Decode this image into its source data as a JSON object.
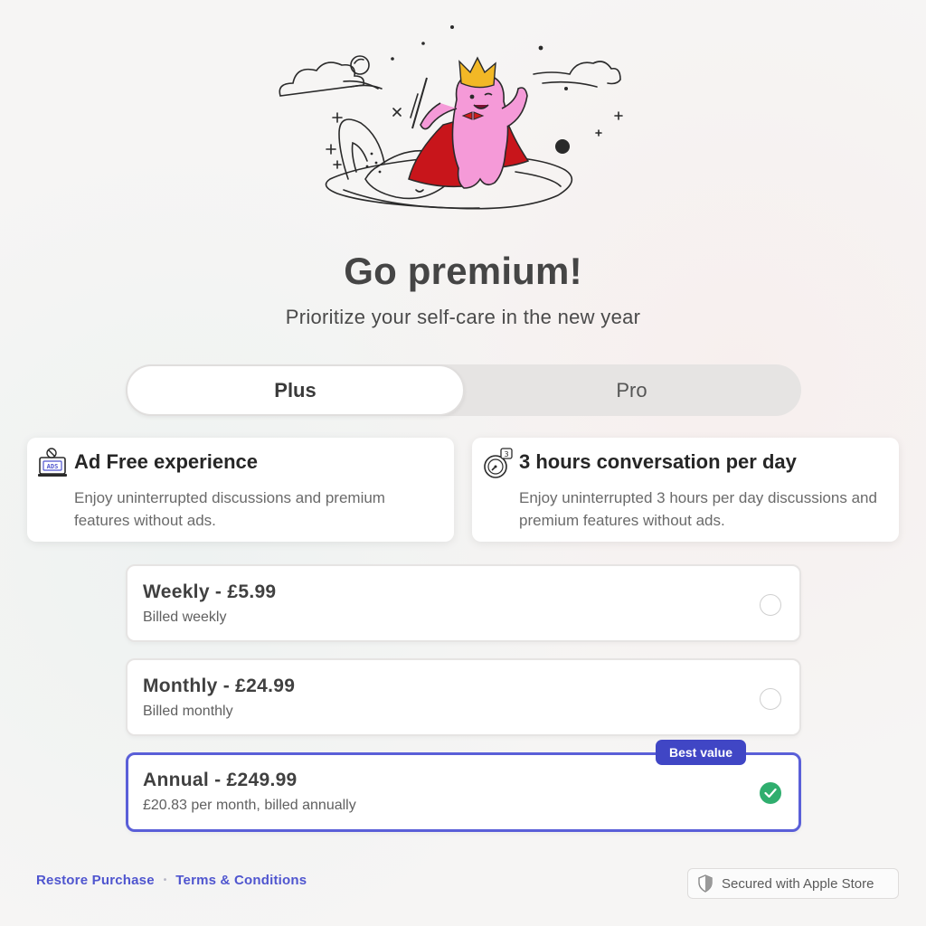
{
  "header": {
    "title": "Go premium!",
    "subtitle": "Prioritize your self-care in the new year"
  },
  "tabs": [
    {
      "label": "Plus",
      "selected": true
    },
    {
      "label": "Pro",
      "selected": false
    }
  ],
  "features": [
    {
      "icon": "no-ads-icon",
      "title": "Ad Free experience",
      "description": "Enjoy uninterrupted discussions and premium features without ads."
    },
    {
      "icon": "timer-3-hours-icon",
      "title": "3 hours conversation per day",
      "description": "Enjoy uninterrupted 3 hours per day discussions and premium features without ads."
    }
  ],
  "plans": [
    {
      "name": "Weekly - £5.99",
      "billing": "Billed weekly",
      "selected": false
    },
    {
      "name": "Monthly - £24.99",
      "billing": "Billed monthly",
      "selected": false
    },
    {
      "name": "Annual - £249.99",
      "billing": "£20.83 per month, billed annually",
      "selected": true,
      "badge": "Best value"
    }
  ],
  "footer": {
    "restore": "Restore Purchase",
    "separator": "•",
    "terms": "Terms & Conditions",
    "secured": "Secured with Apple Store"
  },
  "colors": {
    "accent": "#4046c5",
    "link": "#4f55cf",
    "check": "#2fae6e",
    "mascot": "#f59ad8"
  }
}
